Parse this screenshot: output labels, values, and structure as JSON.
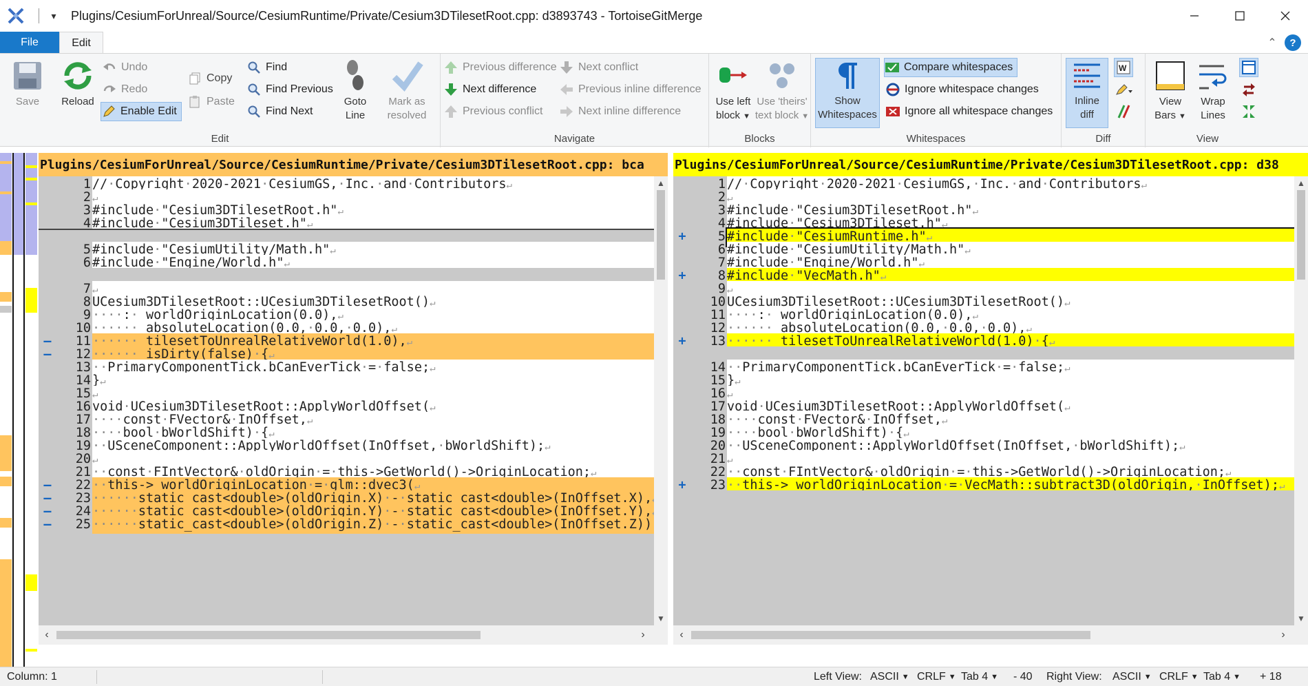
{
  "window": {
    "title": "Plugins/CesiumForUnreal/Source/CesiumRuntime/Private/Cesium3DTilesetRoot.cpp: d3893743 - TortoiseGitMerge",
    "qa_dropdown": "▾"
  },
  "tabs": {
    "file": "File",
    "edit": "Edit"
  },
  "ribbon": {
    "edit": {
      "label": "Edit",
      "save": "Save",
      "reload": "Reload",
      "undo": "Undo",
      "redo": "Redo",
      "enable_edit": "Enable Edit",
      "copy": "Copy",
      "paste": "Paste",
      "find": "Find",
      "find_previous": "Find Previous",
      "find_next": "Find Next",
      "goto_line_1": "Goto",
      "goto_line_2": "Line",
      "mark_resolved_1": "Mark as",
      "mark_resolved_2": "resolved"
    },
    "navigate": {
      "label": "Navigate",
      "previous_difference": "Previous difference",
      "next_difference": "Next difference",
      "previous_conflict": "Previous conflict",
      "next_conflict": "Next conflict",
      "previous_inline_difference": "Previous inline difference",
      "next_inline_difference": "Next inline difference"
    },
    "blocks": {
      "label": "Blocks",
      "use_left_1": "Use left",
      "use_left_2": "block",
      "use_theirs_1": "Use 'theirs'",
      "use_theirs_2": "text block"
    },
    "whitespaces": {
      "label": "Whitespaces",
      "show_1": "Show",
      "show_2": "Whitespaces",
      "compare": "Compare whitespaces",
      "ignore_changes": "Ignore whitespace changes",
      "ignore_all": "Ignore all whitespace changes"
    },
    "diff": {
      "label": "Diff",
      "inline_1": "Inline",
      "inline_2": "diff"
    },
    "view": {
      "label": "View",
      "view_bars_1": "View",
      "view_bars_2": "Bars",
      "wrap_lines_1": "Wrap",
      "wrap_lines_2": "Lines"
    }
  },
  "left_pane": {
    "header": "Plugins/CesiumForUnreal/Source/CesiumRuntime/Private/Cesium3DTilesetRoot.cpp: bca",
    "lines": [
      {
        "num": "1",
        "type": "normal",
        "mk": "",
        "code": "// Copyright 2020-2021 CesiumGS, Inc. and Contributors"
      },
      {
        "num": "2",
        "type": "normal",
        "mk": "",
        "code": ""
      },
      {
        "num": "3",
        "type": "normal",
        "mk": "",
        "code": "#include \"Cesium3DTilesetRoot.h\""
      },
      {
        "num": "4",
        "type": "normal",
        "mk": "",
        "code": "#include \"Cesium3DTileset.h\""
      },
      {
        "num": "",
        "type": "empty",
        "mk": "",
        "code": ""
      },
      {
        "num": "5",
        "type": "normal",
        "mk": "",
        "code": "#include \"CesiumUtility/Math.h\""
      },
      {
        "num": "6",
        "type": "normal",
        "mk": "",
        "code": "#include \"Engine/World.h\""
      },
      {
        "num": "",
        "type": "empty",
        "mk": "",
        "code": ""
      },
      {
        "num": "7",
        "type": "normal",
        "mk": "",
        "code": ""
      },
      {
        "num": "8",
        "type": "normal",
        "mk": "",
        "code": "UCesium3DTilesetRoot::UCesium3DTilesetRoot()"
      },
      {
        "num": "9",
        "type": "normal",
        "mk": "",
        "code": "    : _worldOriginLocation(0.0),"
      },
      {
        "num": "10",
        "type": "normal",
        "mk": "",
        "code": "      _absoluteLocation(0.0, 0.0, 0.0),"
      },
      {
        "num": "11",
        "type": "removed",
        "mk": "—",
        "code": "      _tilesetToUnrealRelativeWorld(1.0),"
      },
      {
        "num": "12",
        "type": "removed",
        "mk": "—",
        "code": "      _isDirty(false) {"
      },
      {
        "num": "13",
        "type": "normal",
        "mk": "",
        "code": "  PrimaryComponentTick.bCanEverTick = false;"
      },
      {
        "num": "14",
        "type": "normal",
        "mk": "",
        "code": "}"
      },
      {
        "num": "15",
        "type": "normal",
        "mk": "",
        "code": ""
      },
      {
        "num": "16",
        "type": "normal",
        "mk": "",
        "code": "void UCesium3DTilesetRoot::ApplyWorldOffset("
      },
      {
        "num": "17",
        "type": "normal",
        "mk": "",
        "code": "    const FVector& InOffset,"
      },
      {
        "num": "18",
        "type": "normal",
        "mk": "",
        "code": "    bool bWorldShift) {"
      },
      {
        "num": "19",
        "type": "normal",
        "mk": "",
        "code": "  USceneComponent::ApplyWorldOffset(InOffset, bWorldShift);"
      },
      {
        "num": "20",
        "type": "normal",
        "mk": "",
        "code": ""
      },
      {
        "num": "21",
        "type": "normal",
        "mk": "",
        "code": "  const FIntVector& oldOrigin = this->GetWorld()->OriginLocation;"
      },
      {
        "num": "22",
        "type": "removed",
        "mk": "—",
        "code": "  this->_worldOriginLocation = glm::dvec3("
      },
      {
        "num": "23",
        "type": "removed",
        "mk": "—",
        "code": "      static_cast<double>(oldOrigin.X) - static_cast<double>(InOffset.X),"
      },
      {
        "num": "24",
        "type": "removed",
        "mk": "—",
        "code": "      static_cast<double>(oldOrigin.Y) - static_cast<double>(InOffset.Y),"
      },
      {
        "num": "25",
        "type": "removed",
        "mk": "—",
        "code": "      static_cast<double>(oldOrigin.Z) - static_cast<double>(InOffset.Z));"
      }
    ]
  },
  "right_pane": {
    "header": "Plugins/CesiumForUnreal/Source/CesiumRuntime/Private/Cesium3DTilesetRoot.cpp: d38",
    "lines": [
      {
        "num": "1",
        "type": "normal",
        "mk": "",
        "code": "// Copyright 2020-2021 CesiumGS, Inc. and Contributors"
      },
      {
        "num": "2",
        "type": "normal",
        "mk": "",
        "code": ""
      },
      {
        "num": "3",
        "type": "normal",
        "mk": "",
        "code": "#include \"Cesium3DTilesetRoot.h\""
      },
      {
        "num": "4",
        "type": "normal",
        "mk": "",
        "code": "#include \"Cesium3DTileset.h\""
      },
      {
        "num": "5",
        "type": "added",
        "mk": "+",
        "code": "#include \"CesiumRuntime.h\""
      },
      {
        "num": "6",
        "type": "normal",
        "mk": "",
        "code": "#include \"CesiumUtility/Math.h\""
      },
      {
        "num": "7",
        "type": "normal",
        "mk": "",
        "code": "#include \"Engine/World.h\""
      },
      {
        "num": "8",
        "type": "added",
        "mk": "+",
        "code": "#include \"VecMath.h\""
      },
      {
        "num": "9",
        "type": "normal",
        "mk": "",
        "code": ""
      },
      {
        "num": "10",
        "type": "normal",
        "mk": "",
        "code": "UCesium3DTilesetRoot::UCesium3DTilesetRoot()"
      },
      {
        "num": "11",
        "type": "normal",
        "mk": "",
        "code": "    : _worldOriginLocation(0.0),"
      },
      {
        "num": "12",
        "type": "normal",
        "mk": "",
        "code": "      _absoluteLocation(0.0, 0.0, 0.0),"
      },
      {
        "num": "13",
        "type": "added",
        "mk": "+",
        "code": "      _tilesetToUnrealRelativeWorld(1.0) {"
      },
      {
        "num": "",
        "type": "empty",
        "mk": "",
        "code": ""
      },
      {
        "num": "14",
        "type": "normal",
        "mk": "",
        "code": "  PrimaryComponentTick.bCanEverTick = false;"
      },
      {
        "num": "15",
        "type": "normal",
        "mk": "",
        "code": "}"
      },
      {
        "num": "16",
        "type": "normal",
        "mk": "",
        "code": ""
      },
      {
        "num": "17",
        "type": "normal",
        "mk": "",
        "code": "void UCesium3DTilesetRoot::ApplyWorldOffset("
      },
      {
        "num": "18",
        "type": "normal",
        "mk": "",
        "code": "    const FVector& InOffset,"
      },
      {
        "num": "19",
        "type": "normal",
        "mk": "",
        "code": "    bool bWorldShift) {"
      },
      {
        "num": "20",
        "type": "normal",
        "mk": "",
        "code": "  USceneComponent::ApplyWorldOffset(InOffset, bWorldShift);"
      },
      {
        "num": "21",
        "type": "normal",
        "mk": "",
        "code": ""
      },
      {
        "num": "22",
        "type": "normal",
        "mk": "",
        "code": "  const FIntVector& oldOrigin = this->GetWorld()->OriginLocation;"
      },
      {
        "num": "23",
        "type": "added",
        "mk": "+",
        "code": "  this->_worldOriginLocation = VecMath::subtract3D(oldOrigin, InOffset);"
      },
      {
        "num": "",
        "type": "empty",
        "mk": "",
        "code": ""
      },
      {
        "num": "",
        "type": "empty",
        "mk": "",
        "code": ""
      },
      {
        "num": "",
        "type": "empty",
        "mk": "",
        "code": ""
      }
    ]
  },
  "status": {
    "column": "Column: 1",
    "left_view": "Left View:",
    "left_encoding": "ASCII",
    "left_eol": "CRLF",
    "left_tab": "Tab 4",
    "left_count": "- 40",
    "right_view": "Right View:",
    "right_encoding": "ASCII",
    "right_eol": "CRLF",
    "right_tab": "Tab 4",
    "right_count": "+ 18"
  },
  "colors": {
    "removed": "#ffc45e",
    "added": "#ffff00",
    "inline_removed": "#e0605a",
    "whitespace_change": "#dcdcff",
    "file_tab": "#1979ca"
  }
}
